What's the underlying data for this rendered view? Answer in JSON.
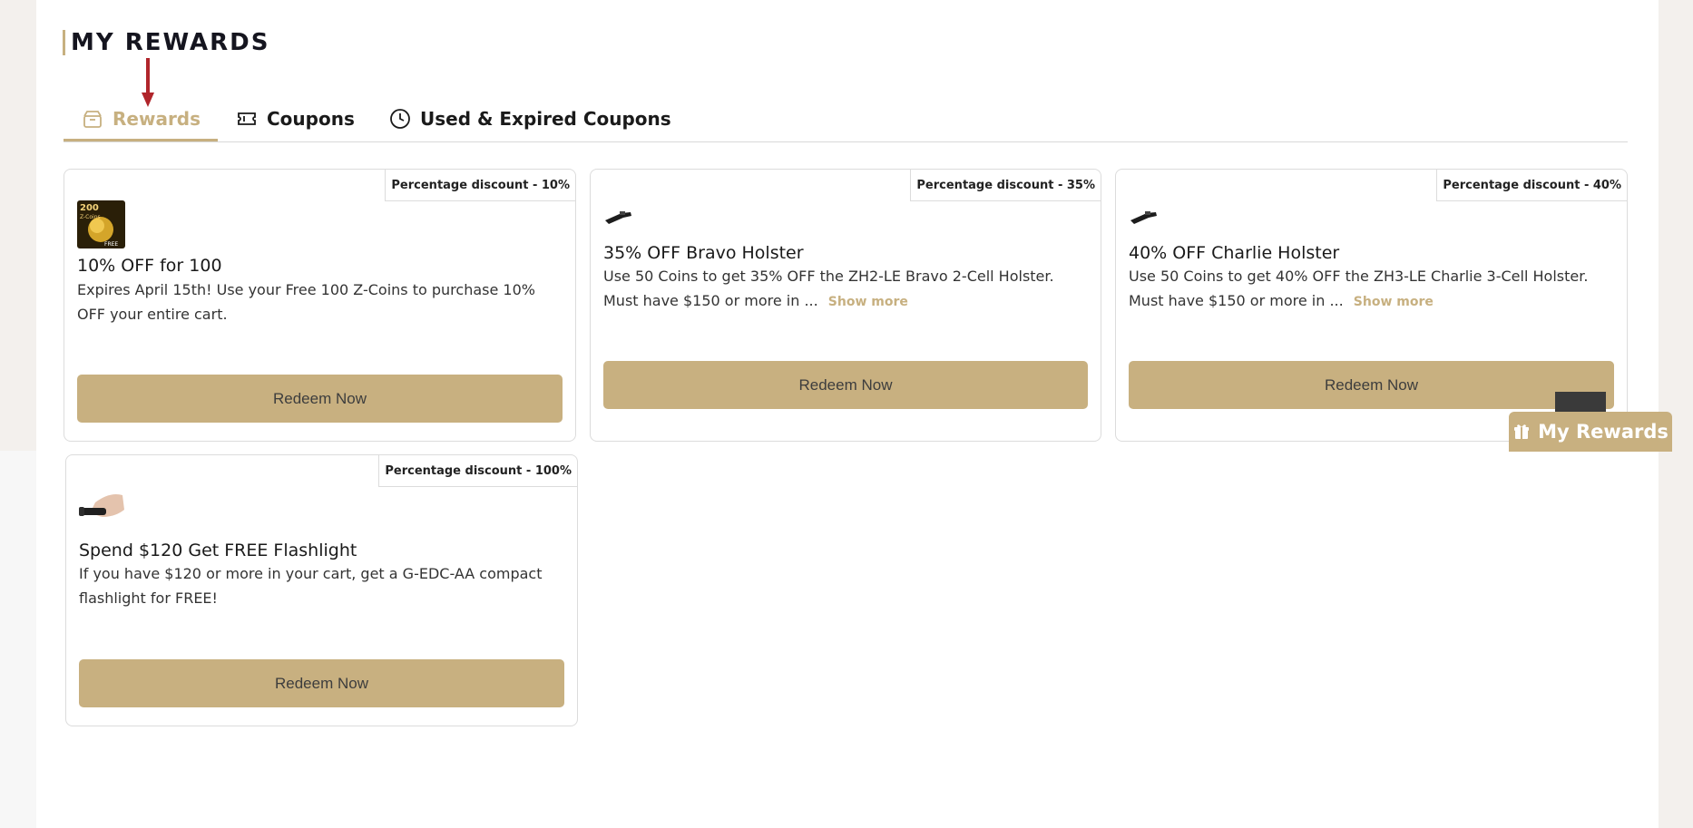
{
  "page": {
    "title": "MY REWARDS"
  },
  "tabs": [
    {
      "label": "Rewards",
      "icon": "gift-box-icon",
      "active": true
    },
    {
      "label": "Coupons",
      "icon": "ticket-icon",
      "active": false
    },
    {
      "label": "Used & Expired Coupons",
      "icon": "clock-icon",
      "active": false
    }
  ],
  "cards": [
    {
      "badge": "Percentage discount - 10%",
      "title": "10% OFF for 100",
      "description": "Expires April 15th! Use your Free 100 Z-Coins to purchase 10% OFF your entire cart.",
      "show_more": "",
      "button": "Redeem Now",
      "image": "200 Z-Coins FREE",
      "image_lines": [
        "200",
        "Z-Coins",
        "FREE"
      ]
    },
    {
      "badge": "Percentage discount - 35%",
      "title": "35% OFF Bravo Holster",
      "description": "Use 50 Coins to get 35% OFF the ZH2-LE Bravo 2-Cell Holster. Must have $150 or more in ...",
      "show_more": "Show more",
      "button": "Redeem Now",
      "image": "holster-icon"
    },
    {
      "badge": "Percentage discount - 40%",
      "title": "40% OFF Charlie Holster",
      "description": "Use 50 Coins to get 40% OFF the ZH3-LE Charlie 3-Cell Holster. Must have $150 or more in ...",
      "show_more": "Show more",
      "button": "Redeem Now",
      "image": "holster-icon"
    },
    {
      "badge": "Percentage discount - 100%",
      "title": "Spend $120 Get FREE Flashlight",
      "description": "If you have $120 or more in your cart, get a G-EDC-AA compact flashlight for FREE!",
      "show_more": "",
      "button": "Redeem Now",
      "image": "flashlight-in-hand-image"
    }
  ],
  "floating_button": {
    "label": "My Rewards",
    "icon": "gift-icon"
  },
  "colors": {
    "accent": "#c8b080",
    "arrow": "#b0252b",
    "text": "#1a1a1a"
  }
}
